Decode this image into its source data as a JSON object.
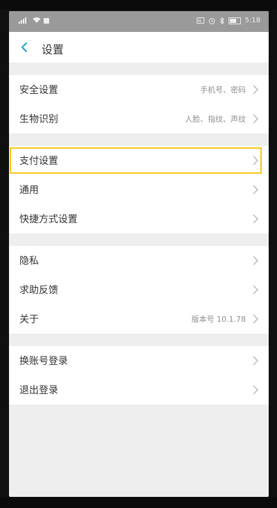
{
  "status_bar": {
    "left_icons": [
      "signal-icon",
      "wifi-icon",
      "notification-icon"
    ],
    "right_icons": [
      "nfc-icon",
      "alarm-icon",
      "bluetooth-icon",
      "battery-icon"
    ],
    "time": "5:18"
  },
  "header": {
    "title": "设置",
    "back_icon": "chevron-left-icon"
  },
  "sections": [
    {
      "items": [
        {
          "label": "安全设置",
          "value": "手机号、密码"
        },
        {
          "label": "生物识别",
          "value": "人脸、指纹、声纹"
        }
      ]
    },
    {
      "items": [
        {
          "label": "支付设置",
          "value": "",
          "highlighted": true
        },
        {
          "label": "通用",
          "value": ""
        },
        {
          "label": "快捷方式设置",
          "value": ""
        }
      ]
    },
    {
      "items": [
        {
          "label": "隐私",
          "value": ""
        },
        {
          "label": "求助反馈",
          "value": ""
        },
        {
          "label": "关于",
          "value": "版本号 10.1.78"
        }
      ]
    },
    {
      "items": [
        {
          "label": "换账号登录",
          "value": ""
        },
        {
          "label": "退出登录",
          "value": ""
        }
      ]
    }
  ],
  "colors": {
    "accent": "#1aa1d8",
    "highlight": "#f5c518",
    "chevron": "#b5b5b5"
  }
}
